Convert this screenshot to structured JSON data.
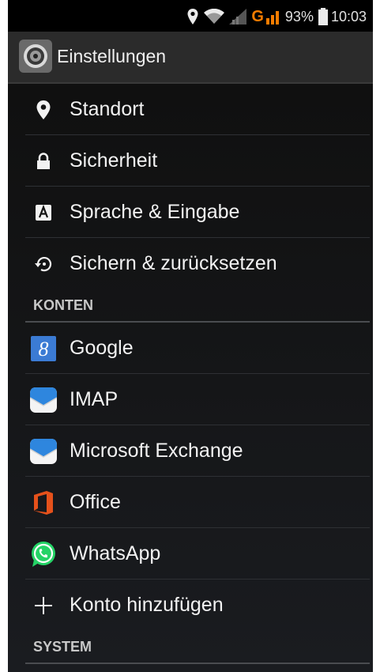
{
  "status_bar": {
    "battery": "93%",
    "time": "10:03",
    "network": "G",
    "icons": [
      "location-icon",
      "wifi-icon",
      "signal-icon",
      "network-signal-icon",
      "battery-icon"
    ]
  },
  "action_bar": {
    "title": "Einstellungen",
    "icon": "settings-app-icon"
  },
  "items": [
    {
      "label": "Standort",
      "icon": "location-pin-icon"
    },
    {
      "label": "Sicherheit",
      "icon": "lock-icon"
    },
    {
      "label": "Sprache & Eingabe",
      "icon": "language-input-icon"
    },
    {
      "label": "Sichern & zurücksetzen",
      "icon": "backup-restore-icon"
    }
  ],
  "sections": {
    "accounts": "KONTEN",
    "system": "SYSTEM"
  },
  "accounts": [
    {
      "label": "Google",
      "icon": "google-icon"
    },
    {
      "label": "IMAP",
      "icon": "email-icon"
    },
    {
      "label": "Microsoft Exchange",
      "icon": "email-icon"
    },
    {
      "label": "Office",
      "icon": "office-icon"
    },
    {
      "label": "WhatsApp",
      "icon": "whatsapp-icon"
    },
    {
      "label": "Konto hinzufügen",
      "icon": "plus-icon"
    }
  ],
  "colors": {
    "office": "#e5511b",
    "whatsapp": "#25d366",
    "google": "#3b7bd4",
    "network": "#f57c00"
  }
}
